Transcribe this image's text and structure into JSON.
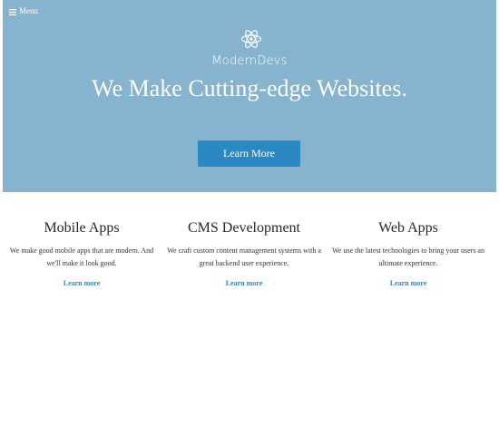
{
  "nav": {
    "menu_label": "Menu",
    "menu_icon": "hamburger-icon"
  },
  "hero": {
    "logo_icon": "atom-icon",
    "brand": "ModernDevs",
    "headline": "We Make Cutting-edge Websites.",
    "cta_label": "Learn More",
    "background_color": "#86b3ce",
    "cta_color": "#2a88c3"
  },
  "features": [
    {
      "title": "Mobile Apps",
      "description": "We make good mobile apps that are modern. And we'll make it look good.",
      "link_label": "Learn more"
    },
    {
      "title": "CMS Development",
      "description": "We craft custom content management systems with a great backend user experience.",
      "link_label": "Learn more"
    },
    {
      "title": "Web Apps",
      "description": "We use the latest technologies to bring your users an ultimate experience.",
      "link_label": "Learn more"
    }
  ]
}
